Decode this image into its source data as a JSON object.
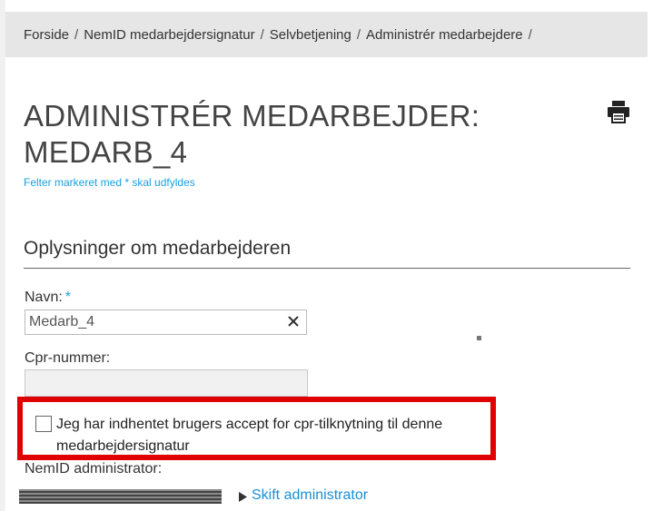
{
  "breadcrumb": {
    "items": [
      "Forside",
      "NemID medarbejdersignatur",
      "Selvbetjening",
      "Administrér medarbejdere"
    ],
    "separator": "/"
  },
  "page": {
    "title_line1": "ADMINISTRÉR MEDARBEJDER:",
    "title_line2": "MEDARB_4",
    "required_note": "Felter markeret med * skal udfyldes"
  },
  "icons": {
    "print": "printer-icon",
    "clear": "clear-x-icon",
    "arrow": "triangle-right-icon"
  },
  "section": {
    "title": "Oplysninger om medarbejderen"
  },
  "form": {
    "name_label": "Navn:",
    "required_marker": "*",
    "name_value": "Medarb_4",
    "cpr_label": "Cpr-nummer:",
    "cpr_value": "",
    "consent_text": "Jeg har indhentet brugers accept for cpr-tilknytning til denne medarbejdersignatur",
    "consent_checked": false,
    "admin_label": "NemID administrator:",
    "switch_admin_label": "Skift administrator"
  },
  "colors": {
    "accent_blue": "#1a8fd6",
    "highlight_red": "#e00000",
    "breadcrumb_bg": "#e6e6e6"
  }
}
